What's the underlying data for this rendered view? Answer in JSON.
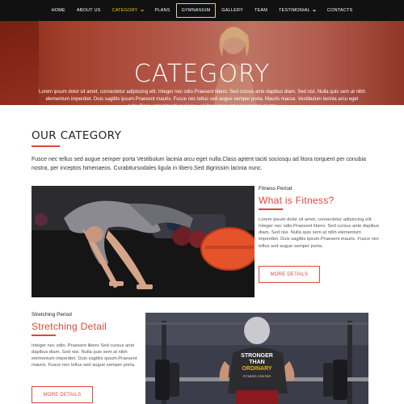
{
  "nav": {
    "items": [
      {
        "label": "HOME"
      },
      {
        "label": "ABOUT US"
      },
      {
        "label": "CATEGORY"
      },
      {
        "label": "PLANS"
      },
      {
        "label": "GYMNASIUM"
      },
      {
        "label": "GALLERY"
      },
      {
        "label": "TEAM"
      },
      {
        "label": "TESTIMONIAL"
      },
      {
        "label": "CONTACTS"
      }
    ],
    "accent_color": "#f0c420"
  },
  "hero": {
    "title": "CATEGORY",
    "text": "Lorem ipsum dolor sit amet, consectetur adipiscing elit. Integer nec odio.Praesent libero. Sed cursus ante dapibus diam. Sed nisi. Nulla quis sem at nibh elementum imperdiet. Duis sagittis ipsum.Praesent mauris. Fusce nec tellus sed augue semper porta. Mauris massa. Vestibulum lacinia arcu eget nulla.Class aptent taciti sociosqu ad litora torquent per conubia nostra"
  },
  "section": {
    "title": "OUR CATEGORY",
    "description": "Fusce nec tellus sed augue semper porta Vestibulum lacinia arcu eget nulla.Class aptent taciti sociosqu ad litora torquent per conubia nostra, per inceptos himenaeos. Curabitursodales ligula in libero.Sed dignissim lacinia nunc."
  },
  "cards": [
    {
      "kicker": "Fitness Period",
      "heading": "What is Fitness?",
      "text": "Lorem ipsum dolor sit amet, consectetur adipiscing elit. Integer nec odio.Praesent libero. Sed cursus ante dapibus diam. Sed nisi. Nulla quis sem at nibh elementum imperdiet. Duis sagittis ipsum.Praesent mauris. Fusce nec tellus sed augue semper porta.",
      "button": "MORE DETAILS"
    },
    {
      "kicker": "Stretching Period",
      "heading": "Stretching Detail",
      "text": "Integer nec odio. Praesent libero Sed cursus ante dapibus diam. Sed nisi. Nulla quis sem at nibh elementum imperdiet. Duis sagittis ipsum.Praesent mauris. Fusce nec tellus sed augue semper porta.",
      "button": "MORE DETAILS"
    }
  ],
  "images": {
    "shirt_text": "STRONGER THAN ORDINARY",
    "shirt_small": "FITNESS CENTER"
  },
  "colors": {
    "accent": "#e0473a",
    "nav_bg": "#111111"
  }
}
